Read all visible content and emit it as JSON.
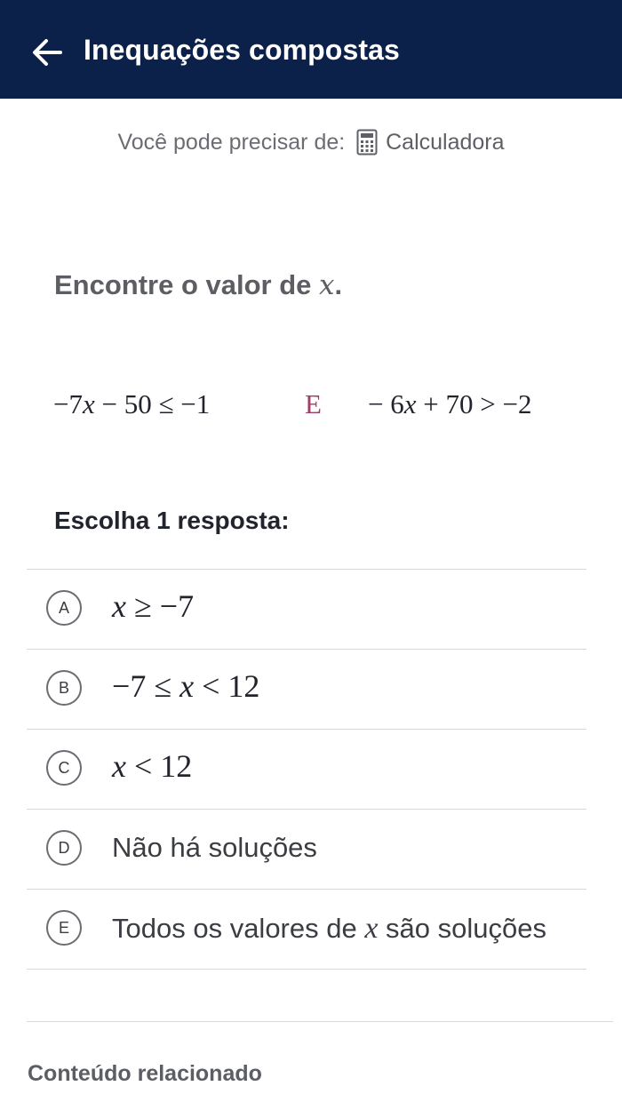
{
  "header": {
    "title": "Inequações compostas",
    "back_icon": "arrow-left-icon",
    "background": "#0c2149"
  },
  "tools": {
    "prefix": "Você pode precisar de:",
    "icon": "calculator-icon",
    "label": "Calculadora"
  },
  "question": {
    "prompt_text": "Encontre o valor de ",
    "prompt_var": "x",
    "prompt_end": ".",
    "inequality_left": "−7x − 50 ≤ −1",
    "connector": "E",
    "inequality_right": "− 6x + 70 > −2"
  },
  "choose_label": "Escolha 1 resposta:",
  "choices": [
    {
      "letter": "A",
      "text": "x ≥ −7"
    },
    {
      "letter": "B",
      "text": "−7 ≤ x < 12"
    },
    {
      "letter": "C",
      "text": "x < 12"
    },
    {
      "letter": "D",
      "text": "Não há soluções"
    },
    {
      "letter": "E",
      "text_before": "Todos os valores de ",
      "var": "x",
      "text_after": " são soluções"
    }
  ],
  "related": "Conteúdo relacionado",
  "colors": {
    "connector": "#a03d6b",
    "text": "#21242c",
    "muted": "#5c5e64",
    "divider": "#d6d8da"
  }
}
